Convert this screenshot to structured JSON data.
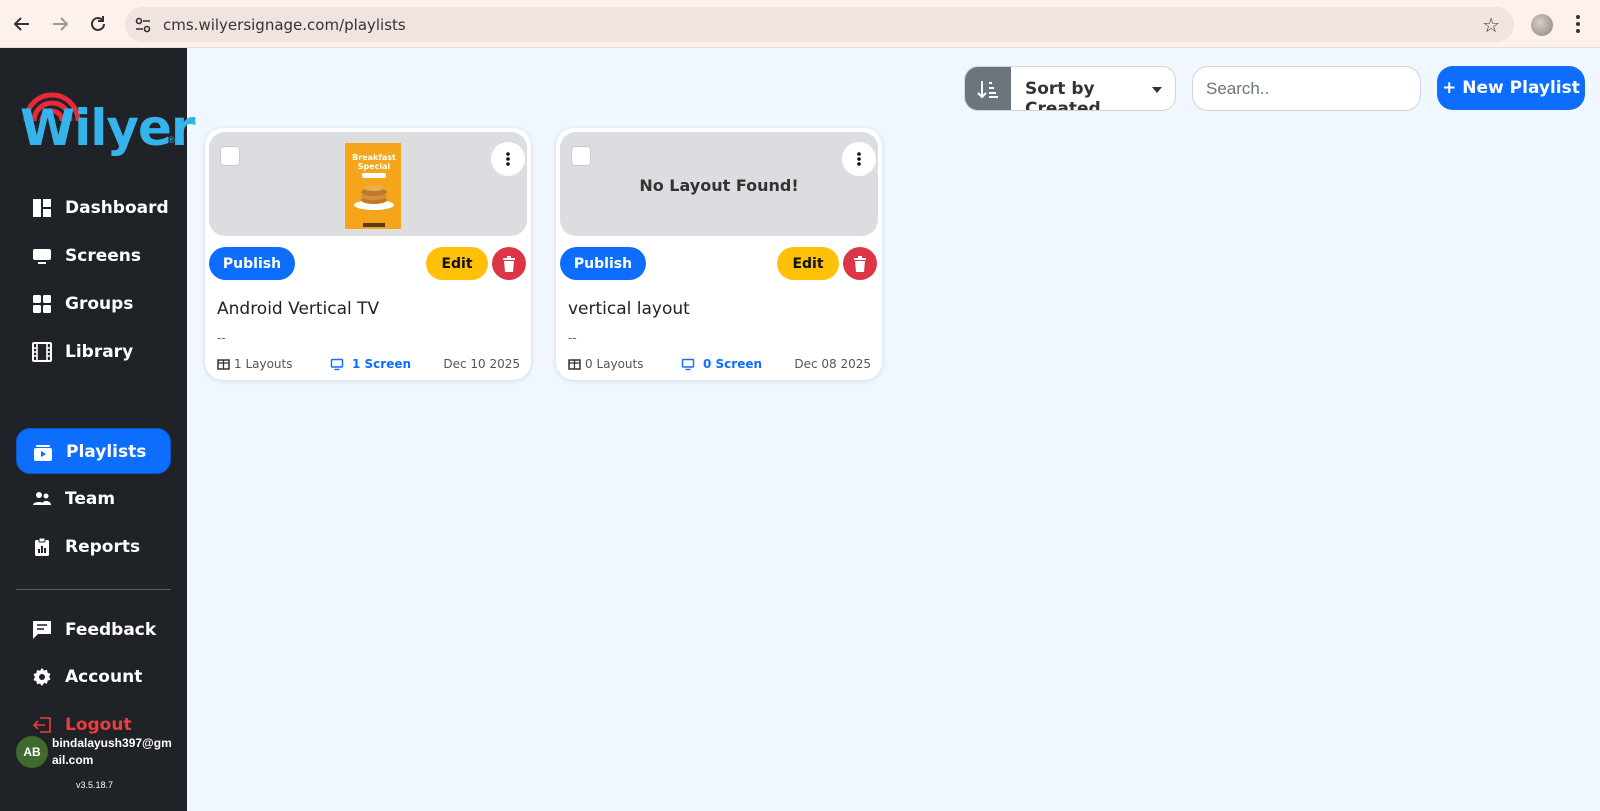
{
  "browser": {
    "url": "cms.wilyersignage.com/playlists"
  },
  "brand": {
    "logo_text": "Wilyer",
    "registered": "®",
    "accent": "#0d6efd",
    "logo_color": "#35b3ea"
  },
  "sidebar": {
    "items": [
      {
        "label": "Dashboard",
        "icon": "dashboard-icon"
      },
      {
        "label": "Screens",
        "icon": "monitor-icon"
      },
      {
        "label": "Groups",
        "icon": "grid-icon"
      },
      {
        "label": "Library",
        "icon": "film-icon"
      },
      {
        "label": "Playlists",
        "icon": "playlist-icon",
        "active": true
      },
      {
        "label": "Team",
        "icon": "people-icon"
      },
      {
        "label": "Reports",
        "icon": "clipboard-icon"
      }
    ],
    "secondary": [
      {
        "label": "Feedback",
        "icon": "chat-icon"
      },
      {
        "label": "Account",
        "icon": "gear-icon"
      },
      {
        "label": "Logout",
        "icon": "logout-icon"
      }
    ],
    "user": {
      "initials": "AB",
      "email": "bindalayush397@gmail.com"
    },
    "version": "v3.5.18.7"
  },
  "toolbar": {
    "sort_label": "Sort by Created",
    "search_placeholder": "Search..",
    "new_button": "+ New Playlist"
  },
  "playlists": [
    {
      "title": "Android Vertical TV",
      "description": "--",
      "layouts": "1 Layouts",
      "screens": "1 Screen",
      "date": "Dec 10 2025",
      "has_preview": true,
      "publish": "Publish",
      "edit": "Edit"
    },
    {
      "title": "vertical layout",
      "description": "--",
      "layouts": "0 Layouts",
      "screens": "0 Screen",
      "date": "Dec 08 2025",
      "has_preview": false,
      "empty_text": "No Layout Found!",
      "publish": "Publish",
      "edit": "Edit"
    }
  ],
  "poster": {
    "line1": "Breakfast",
    "line2": "Special"
  }
}
